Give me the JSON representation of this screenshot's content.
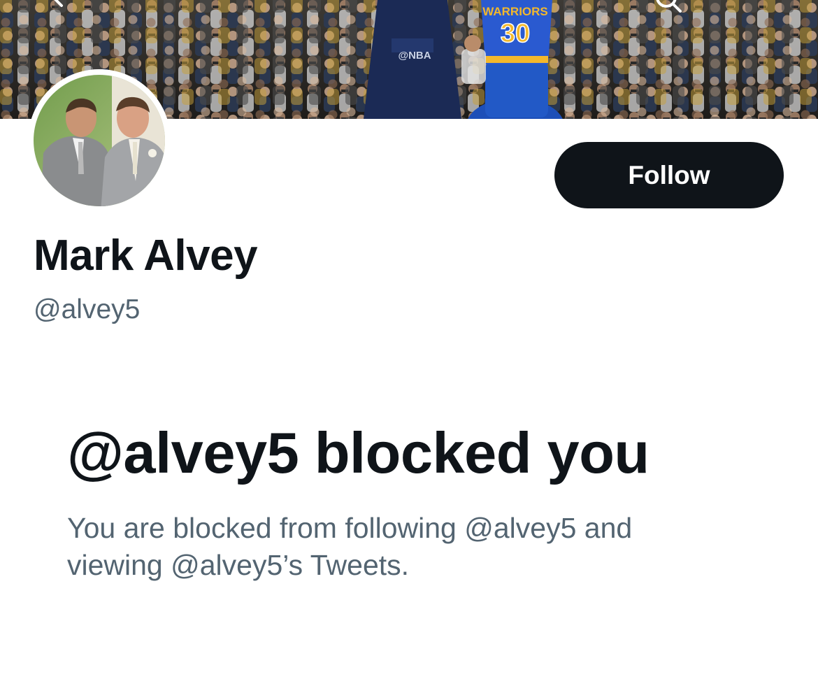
{
  "profile": {
    "display_name": "Mark Alvey",
    "handle": "@alvey5"
  },
  "header": {
    "back_icon": "arrow-left-icon",
    "search_icon": "search-icon",
    "banner_print": {
      "jersey_team": "WARRIORS",
      "jersey_number": "30",
      "stanchion_logo": "@NBA"
    }
  },
  "actions": {
    "follow_label": "Follow"
  },
  "blocked": {
    "title": "@alvey5 blocked you",
    "line1": "You are blocked from following @alvey5 and",
    "line2": "viewing @alvey5’s Tweets."
  },
  "colors": {
    "primary_text": "#0f1419",
    "secondary_text": "#536471",
    "button_bg": "#0f1419",
    "button_text": "#ffffff",
    "background": "#ffffff"
  }
}
